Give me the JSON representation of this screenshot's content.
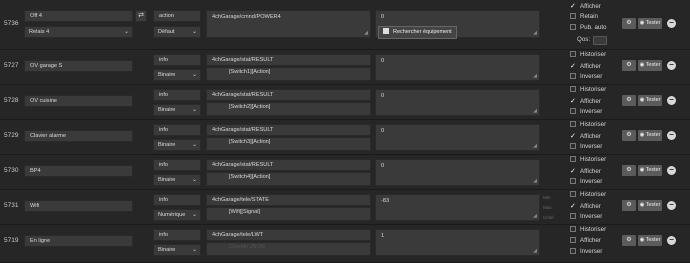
{
  "commands": [
    {
      "id": "5736",
      "name": "Off 4",
      "parent": "Relais 4",
      "type": "action",
      "subtype": "Défaut",
      "topic": "4chGarage/cmnd/POWER4",
      "template": "",
      "value": "0",
      "checks": [
        {
          "label": "Afficher",
          "checked": true
        },
        {
          "label": "Retain",
          "checked": false
        },
        {
          "label": "Pub. auto",
          "checked": false
        }
      ],
      "qos_label": "Qos:",
      "qos_value": "1",
      "tooltip": "Rechercher équipement"
    },
    {
      "id": "5727",
      "name": "OV garage S",
      "type": "info",
      "subtype": "Binaire",
      "topic": "4chGarage/stat/RESULT",
      "template": "[Switch1][Action]",
      "value": "0",
      "checks": [
        {
          "label": "Historiser",
          "checked": false
        },
        {
          "label": "Afficher",
          "checked": true
        },
        {
          "label": "Inverser",
          "checked": false
        }
      ]
    },
    {
      "id": "5728",
      "name": "OV cuisine",
      "type": "info",
      "subtype": "Binaire",
      "topic": "4chGarage/stat/RESULT",
      "template": "[Switch2][Action]",
      "value": "0",
      "checks": [
        {
          "label": "Historiser",
          "checked": false
        },
        {
          "label": "Afficher",
          "checked": true
        },
        {
          "label": "Inverser",
          "checked": false
        }
      ]
    },
    {
      "id": "5729",
      "name": "Clavier alarme",
      "type": "info",
      "subtype": "Binaire",
      "topic": "4chGarage/stat/RESULT",
      "template": "[Switch3][Action]",
      "value": "0",
      "checks": [
        {
          "label": "Historiser",
          "checked": false
        },
        {
          "label": "Afficher",
          "checked": true
        },
        {
          "label": "Inverser",
          "checked": false
        }
      ]
    },
    {
      "id": "5730",
      "name": "BP4",
      "type": "info",
      "subtype": "Binaire",
      "topic": "4chGarage/stat/RESULT",
      "template": "[Switch4][Action]",
      "value": "0",
      "checks": [
        {
          "label": "Historiser",
          "checked": false
        },
        {
          "label": "Afficher",
          "checked": true
        },
        {
          "label": "Inverser",
          "checked": false
        }
      ]
    },
    {
      "id": "5731",
      "name": "Wifi",
      "type": "info",
      "subtype": "Numérique",
      "topic": "4chGarage/tele/STATE",
      "template": "[Wifi][Signal]",
      "value": "-83",
      "minmax": {
        "min": "Min",
        "max": "Max",
        "unit": "Unité"
      },
      "checks": [
        {
          "label": "Historiser",
          "checked": false
        },
        {
          "label": "Afficher",
          "checked": true
        },
        {
          "label": "Inverser",
          "checked": false
        }
      ]
    },
    {
      "id": "5719",
      "name": "En ligne",
      "type": "info",
      "subtype": "Binaire",
      "topic": "4chGarage/tele/LWT",
      "template": "",
      "template_placeholder": "Chemin JSON",
      "value": "1",
      "checks": [
        {
          "label": "Historiser",
          "checked": false
        },
        {
          "label": "Afficher",
          "checked": false
        },
        {
          "label": "Inverser",
          "checked": false
        }
      ]
    }
  ],
  "buttons": {
    "configure_icon": "gears-icon",
    "test_label": "Tester",
    "test_icon": "rss-icon",
    "remove_icon": "minus-circle-icon"
  }
}
